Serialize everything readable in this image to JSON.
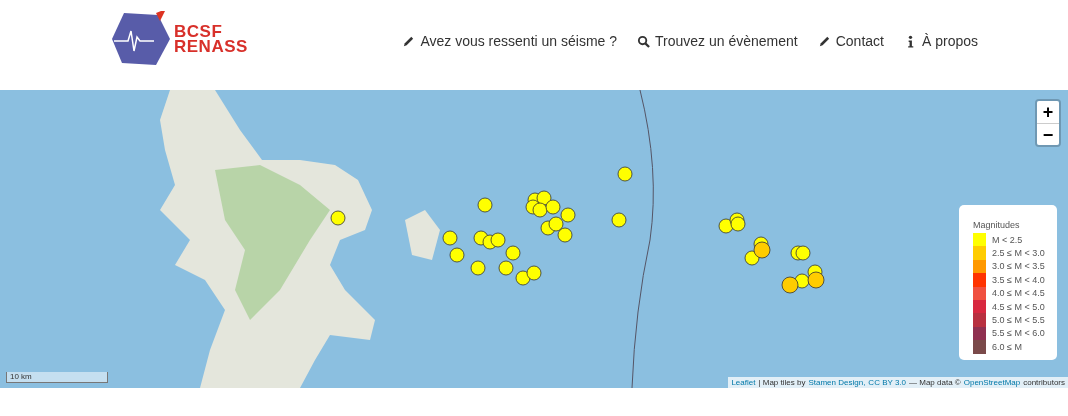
{
  "logo": {
    "line_1": "BCSF",
    "line_2": "RENASS"
  },
  "nav": [
    {
      "kind": "pencil",
      "label": "Avez vous ressenti un séisme ?"
    },
    {
      "kind": "search",
      "label": "Trouvez un évènement"
    },
    {
      "kind": "pencil",
      "label": "Contact"
    },
    {
      "kind": "info",
      "label": "À propos"
    }
  ],
  "map": {
    "zoom_in": "+",
    "zoom_out": "−",
    "scale": "10 km",
    "legend": {
      "title": "Magnitudes",
      "items": [
        {
          "label": "M < 2.5",
          "color": "#ffff00"
        },
        {
          "label": "2.5 ≤ M < 3.0",
          "color": "#ffcc00"
        },
        {
          "label": "3.0 ≤ M < 3.5",
          "color": "#ff9900"
        },
        {
          "label": "3.5 ≤ M < 4.0",
          "color": "#ff3300"
        },
        {
          "label": "4.0 ≤ M < 4.5",
          "color": "#f05040"
        },
        {
          "label": "4.5 ≤ M < 5.0",
          "color": "#d82840"
        },
        {
          "label": "5.0 ≤ M < 5.5",
          "color": "#b83040"
        },
        {
          "label": "5.5 ≤ M < 6.0",
          "color": "#903050"
        },
        {
          "label": "6.0 ≤ M",
          "color": "#7a4a4a"
        }
      ]
    },
    "attribution": [
      {
        "kind": "link",
        "text": "Leaflet"
      },
      {
        "kind": "text",
        "text": "| Map tiles by"
      },
      {
        "kind": "link",
        "text": "Stamen Design,"
      },
      {
        "kind": "link",
        "text": "CC BY 3.0"
      },
      {
        "kind": "text",
        "text": "— Map data ©"
      },
      {
        "kind": "link",
        "text": "OpenStreetMap"
      },
      {
        "kind": "text",
        "text": "contributors"
      }
    ]
  }
}
